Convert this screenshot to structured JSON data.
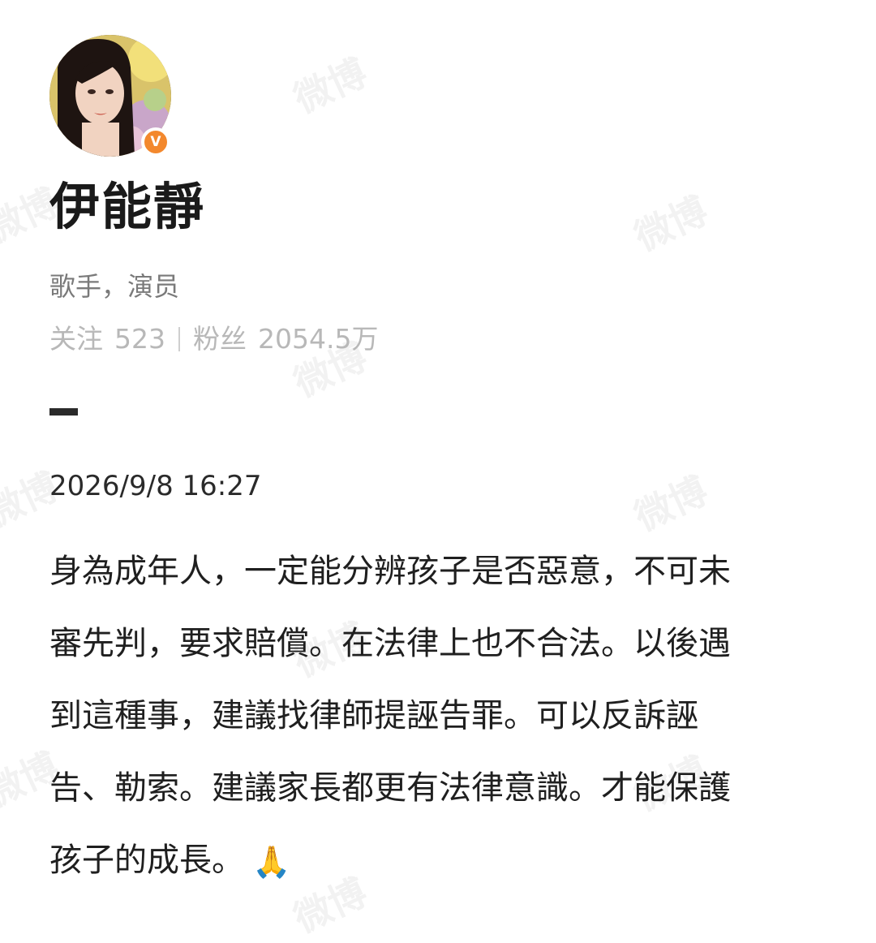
{
  "profile": {
    "name": "伊能靜",
    "bio": "歌手，演员",
    "following_label": "关注",
    "following_count": "523",
    "followers_label": "粉丝",
    "followers_count": "2054.5万",
    "verified_icon": "verified-v-icon",
    "verified_text": "V",
    "accent_color": "#f3882d"
  },
  "post": {
    "time": "2026/9/8 16:27",
    "lines": [
      "身為成年人，一定能分辨孩子是否惡意，不可未",
      "審先判，要求賠償。在法律上也不合法。以後遇",
      "到這種事，建議找律師提誣告罪。可以反訴誣",
      "告、勒索。建議家長都更有法律意識。才能保護",
      "孩子的成長。"
    ],
    "emoji_icon": "folded-hands-icon",
    "emoji": "🙏"
  },
  "watermark": {
    "text": "微博"
  }
}
